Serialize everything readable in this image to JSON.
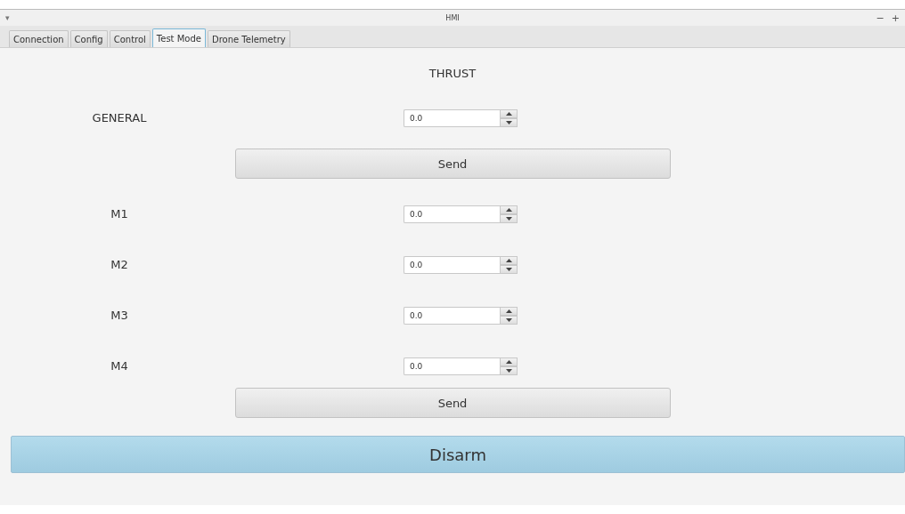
{
  "window": {
    "menu_glyph": "▾",
    "title": "HMI",
    "controls": [
      "−",
      "+"
    ]
  },
  "tabs": [
    {
      "label": "Connection",
      "selected": false
    },
    {
      "label": "Config",
      "selected": false
    },
    {
      "label": "Control",
      "selected": false
    },
    {
      "label": "Test Mode",
      "selected": true
    },
    {
      "label": "Drone Telemetry",
      "selected": false
    }
  ],
  "heading": "THRUST",
  "general": {
    "label": "GENERAL",
    "value": "0.0"
  },
  "send_buttons": [
    "Send",
    "Send"
  ],
  "motors": [
    {
      "label": "M1",
      "value": "0.0"
    },
    {
      "label": "M2",
      "value": "0.0"
    },
    {
      "label": "M3",
      "value": "0.0"
    },
    {
      "label": "M4",
      "value": "0.0"
    }
  ],
  "disarm": "Disarm"
}
